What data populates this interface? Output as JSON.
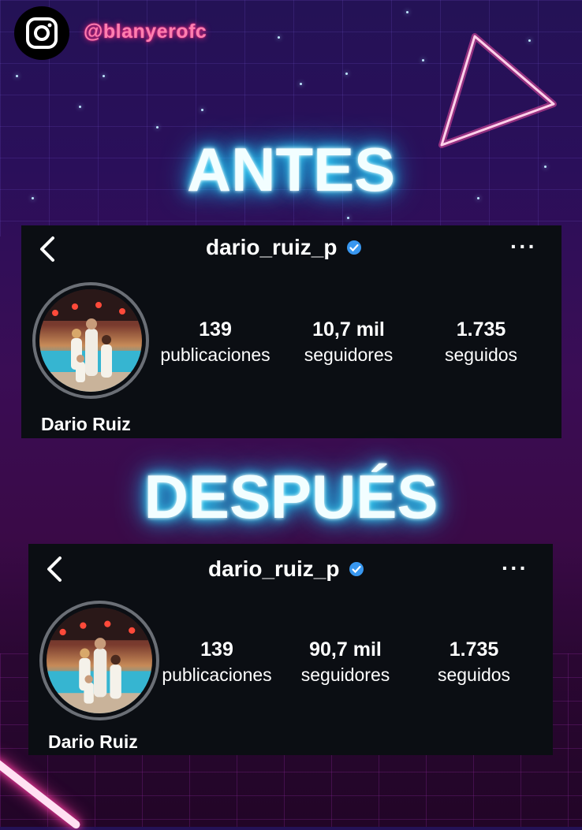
{
  "header": {
    "instagram_icon": "instagram-icon",
    "handle": "@blanyerofc"
  },
  "before": {
    "title": "ANTES",
    "profile": {
      "username": "dario_ruiz_p",
      "name": "Dario Ruiz",
      "posts_count": "139",
      "posts_label": "publicaciones",
      "followers_count": "10,7 mil",
      "followers_label": "seguidores",
      "following_count": "1.735",
      "following_label": "seguidos",
      "more_label": "···"
    }
  },
  "after": {
    "title": "DESPUÉS",
    "profile": {
      "username": "dario_ruiz_p",
      "name": "Dario Ruiz",
      "posts_count": "139",
      "posts_label": "publicaciones",
      "followers_count": "90,7 mil",
      "followers_label": "seguidores",
      "following_count": "1.735",
      "following_label": "seguidos",
      "more_label": "···"
    }
  },
  "colors": {
    "neon_blue": "#19c6ff",
    "neon_pink": "#ff2e85",
    "card_bg": "#0b0e13",
    "verified_blue": "#3897f0"
  }
}
